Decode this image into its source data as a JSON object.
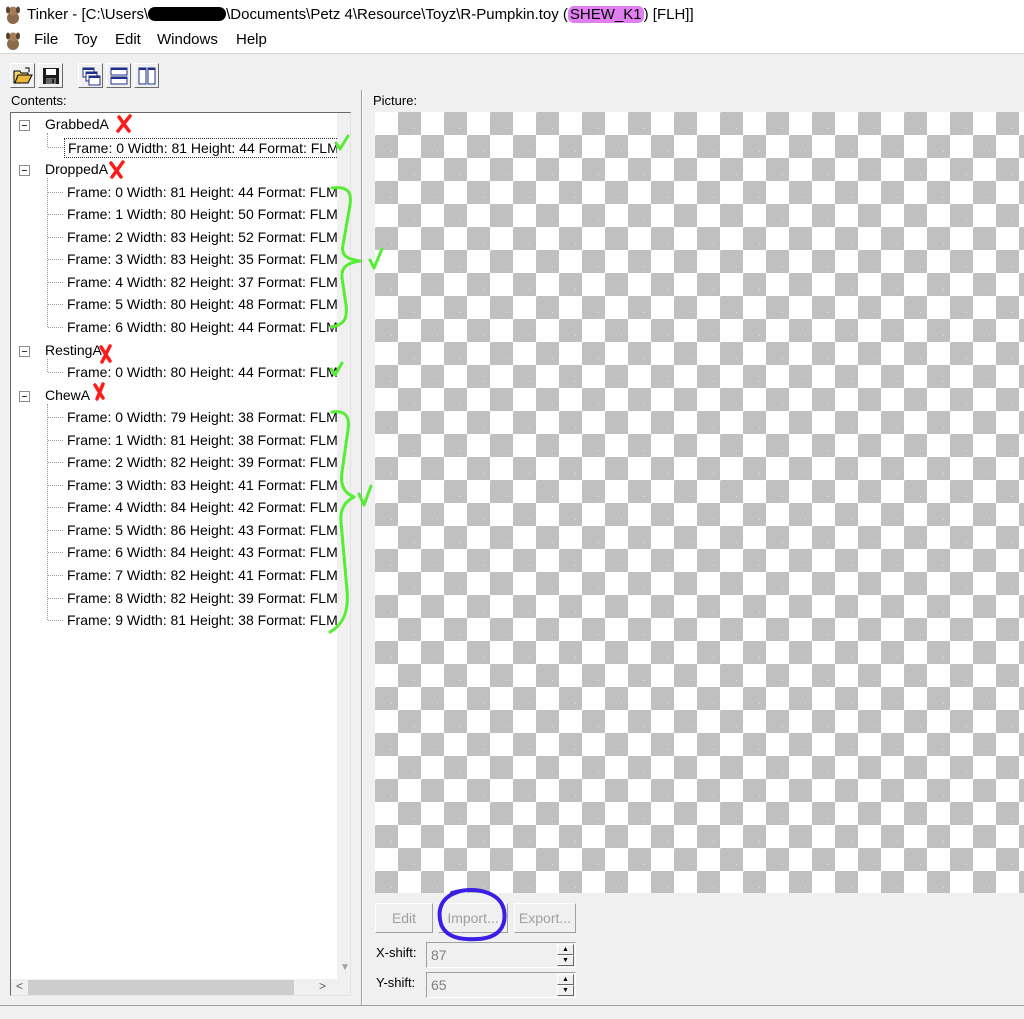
{
  "window": {
    "title_prefix": "Tinker - [C:\\Users\\",
    "title_mid": "\\Documents\\Petz 4\\Resource\\Toyz\\R-Pumpkin.toy (",
    "title_highlight": "SHEW_K1",
    "title_suffix": ") [FLH]]"
  },
  "menu": [
    "File",
    "Toy",
    "Edit",
    "Windows",
    "Help"
  ],
  "toolbar": [
    "open-icon",
    "save-icon",
    "cascade-icon",
    "tile-horizontal-icon",
    "tile-vertical-icon"
  ],
  "contents_label": "Contents:",
  "picture_label": "Picture:",
  "tree": [
    {
      "name": "GrabbedA",
      "frames": [
        "Frame: 0 Width: 81 Height: 44 Format: FLM"
      ]
    },
    {
      "name": "DroppedA",
      "frames": [
        "Frame: 0 Width: 81 Height: 44 Format: FLM",
        "Frame: 1 Width: 80 Height: 50 Format: FLM",
        "Frame: 2 Width: 83 Height: 52 Format: FLM",
        "Frame: 3 Width: 83 Height: 35 Format: FLM",
        "Frame: 4 Width: 82 Height: 37 Format: FLM",
        "Frame: 5 Width: 80 Height: 48 Format: FLM",
        "Frame: 6 Width: 80 Height: 44 Format: FLM"
      ]
    },
    {
      "name": "RestingA",
      "frames": [
        "Frame: 0 Width: 80 Height: 44 Format: FLM"
      ]
    },
    {
      "name": "ChewA",
      "frames": [
        "Frame: 0 Width: 79 Height: 38 Format: FLM",
        "Frame: 1 Width: 81 Height: 38 Format: FLM",
        "Frame: 2 Width: 82 Height: 39 Format: FLM",
        "Frame: 3 Width: 83 Height: 41 Format: FLM",
        "Frame: 4 Width: 84 Height: 42 Format: FLM",
        "Frame: 5 Width: 86 Height: 43 Format: FLM",
        "Frame: 6 Width: 84 Height: 43 Format: FLM",
        "Frame: 7 Width: 82 Height: 41 Format: FLM",
        "Frame: 8 Width: 82 Height: 39 Format: FLM",
        "Frame: 9 Width: 81 Height: 38 Format: FLM"
      ]
    }
  ],
  "buttons": {
    "edit": "Edit",
    "import": "Import...",
    "export": "Export..."
  },
  "xshift": {
    "label": "X-shift:",
    "value": "87"
  },
  "yshift": {
    "label": "Y-shift:",
    "value": "65"
  },
  "colors": {
    "annotation_red": "#ff1a1a",
    "annotation_green": "#55ee33",
    "annotation_blue": "#3a1ee6",
    "title_highlight": "#e07ff0"
  }
}
